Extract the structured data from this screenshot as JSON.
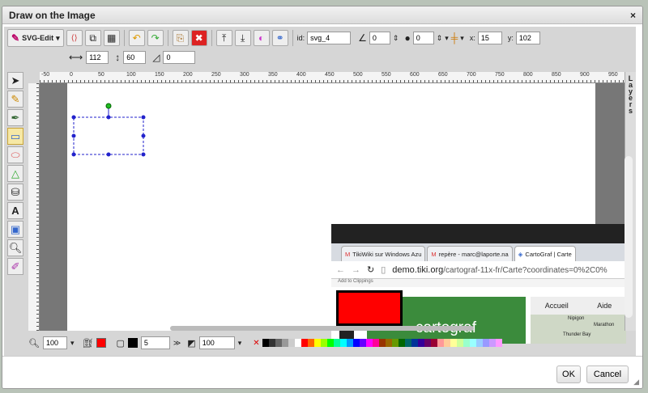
{
  "dialog": {
    "title": "Draw on the Image",
    "close": "×"
  },
  "toolbar": {
    "logo": "SVG-Edit",
    "id_label": "id:",
    "id_value": "svg_4",
    "angle_value": "0",
    "blur_value": "0",
    "x_label": "x:",
    "x_value": "15",
    "y_label": "y:",
    "y_value": "102",
    "width_value": "112",
    "height_value": "60",
    "radius_value": "0"
  },
  "ruler": {
    "top": [
      "-50",
      "0",
      "50",
      "100",
      "150",
      "200",
      "250",
      "300",
      "350",
      "400",
      "450",
      "500",
      "550",
      "600",
      "650",
      "700",
      "750",
      "800",
      "850",
      "900",
      "950"
    ]
  },
  "layers_label": "Layers",
  "bottom": {
    "zoom": "100",
    "stroke_width": "5",
    "opacity": "100"
  },
  "palette": [
    "#000000",
    "#333333",
    "#666666",
    "#999999",
    "#cccccc",
    "#ffffff",
    "#ff0000",
    "#ff6600",
    "#ffff00",
    "#99ff00",
    "#00ff00",
    "#00ff99",
    "#00ffff",
    "#0099ff",
    "#0000ff",
    "#6600ff",
    "#ff00ff",
    "#ff0099",
    "#993300",
    "#996600",
    "#669900",
    "#006600",
    "#006666",
    "#003399",
    "#330099",
    "#660066",
    "#990033",
    "#ff9999",
    "#ffcc99",
    "#ffff99",
    "#ccff99",
    "#99ffcc",
    "#99ffff",
    "#99ccff",
    "#9999ff",
    "#cc99ff",
    "#ff99ff"
  ],
  "screenshot": {
    "tabs": [
      "TikiWiki sur Windows Azu",
      "repère - marc@laporte.na",
      "CartoGraf | Carte"
    ],
    "url_host": "demo.tiki.org",
    "url_path": "/cartograf-11x-fr/Carte?coordinates=0%2C0%",
    "bookmarks": "Add to Clippings",
    "brand": "cartograf",
    "nav1": "Accueil",
    "nav2": "Aide",
    "map1": "Nipigon",
    "map2": "Marathon",
    "map3": "Thunder Bay"
  },
  "footer": {
    "ok": "OK",
    "cancel": "Cancel"
  }
}
